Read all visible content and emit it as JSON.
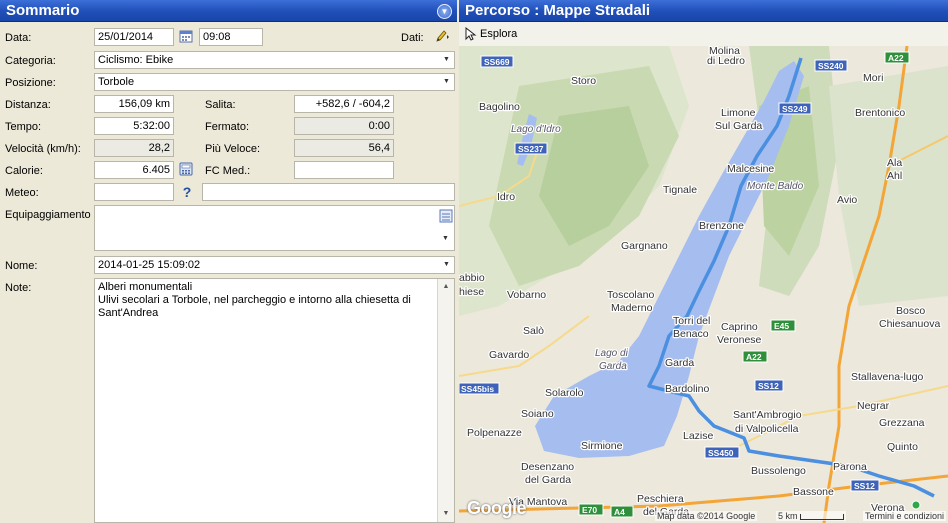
{
  "left_panel": {
    "title": "Sommario",
    "data_label": "Data:",
    "date_value": "25/01/2014",
    "time_value": "09:08",
    "dati_label": "Dati:",
    "categoria_label": "Categoria:",
    "categoria_value": "Ciclismo: Ebike",
    "posizione_label": "Posizione:",
    "posizione_value": "Torbole",
    "distanza_label": "Distanza:",
    "distanza_value": "156,09 km",
    "salita_label": "Salita:",
    "salita_value": "+582,6 / -604,2",
    "tempo_label": "Tempo:",
    "tempo_value": "5:32:00",
    "fermato_label": "Fermato:",
    "fermato_value": "0:00",
    "velocita_label": "Velocità (km/h):",
    "velocita_value": "28,2",
    "piu_veloce_label": "Più Veloce:",
    "piu_veloce_value": "56,4",
    "calorie_label": "Calorie:",
    "calorie_value": "6.405",
    "fc_med_label": "FC Med.:",
    "fc_med_value": "",
    "meteo_label": "Meteo:",
    "meteo_value": "",
    "meteo_help": "?",
    "equip_label": "Equipaggiamento",
    "nome_label": "Nome:",
    "nome_value": "2014-01-25 15:09:02",
    "note_label": "Note:",
    "note_line1": "Alberi monumentali",
    "note_line2": "Ulivi secolari a Torbole, nel parcheggio e intorno alla chiesetta di",
    "note_line3": "Sant'Andrea"
  },
  "right_panel": {
    "title": "Percorso  : Mappe Stradali",
    "explore_label": "Esplora"
  },
  "map": {
    "places": [
      "Molina di Ledro",
      "Storo",
      "Mori",
      "Bagolino",
      "Brentonico",
      "Lago d'Idro",
      "Limone sul Garda",
      "Ala",
      "Ahl",
      "Malcesine",
      "Monte Baldo",
      "Idro",
      "Tignale",
      "Avio",
      "Brenzone",
      "Gargnano",
      "abbio",
      "hiese",
      "Vobarno",
      "Toscolano Maderno",
      "Bosco Chiesanuova",
      "Torri del Benaco",
      "Caprino Veronese",
      "Salò",
      "Lago di Garda",
      "Gavardo",
      "Garda",
      "Stallavena-lugo",
      "Bardolino",
      "Solarolo",
      "Negrar",
      "Soiano",
      "Lazise",
      "Sant'Ambrogio di Valpolicella",
      "Grezzana",
      "Sirmione",
      "Quinto",
      "Desenzano del Garda",
      "Bussolengo",
      "Parona",
      "Via Mantova",
      "Bassone",
      "Peschiera del Garda",
      "Verona"
    ],
    "roads": [
      "SS669",
      "SS240",
      "A22",
      "SS237",
      "SS249",
      "E45",
      "A22",
      "SS12",
      "SS45bis",
      "SS450",
      "E70",
      "A4",
      "SS12"
    ],
    "google_logo": "Google",
    "copyright": "Map data ©2014 Google",
    "scale": "5 km",
    "terms": "Termini e condizioni",
    "colors": {
      "lake": "#a6bdf0",
      "route": "#4a8fe0",
      "highway": "#f3a537"
    }
  }
}
